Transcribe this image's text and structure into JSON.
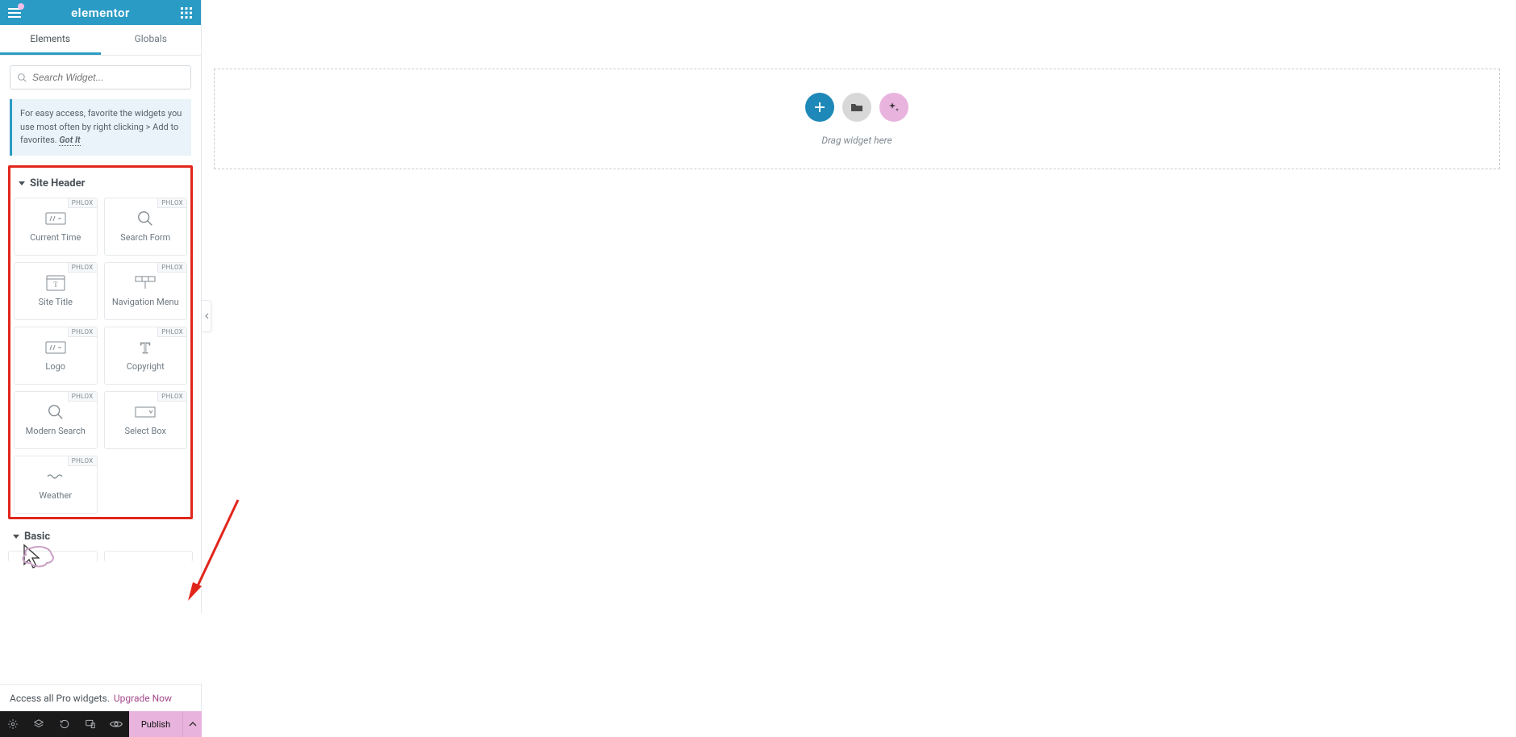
{
  "header": {
    "brand": "elementor"
  },
  "tabs": {
    "elements": "Elements",
    "globals": "Globals"
  },
  "search": {
    "placeholder": "Search Widget..."
  },
  "tip": {
    "text": "For easy access, favorite the widgets you use most often by right clicking > Add to favorites. ",
    "gotit": "Got It"
  },
  "categories": {
    "siteheader": "Site Header",
    "basic": "Basic"
  },
  "tag": "PHLOX",
  "widgets": {
    "current_time": "Current Time",
    "search_form": "Search Form",
    "site_title": "Site Title",
    "navigation_menu": "Navigation Menu",
    "logo": "Logo",
    "copyright": "Copyright",
    "modern_search": "Modern Search",
    "select_box": "Select Box",
    "weather": "Weather"
  },
  "pro_banner": {
    "text": "Access all Pro widgets.",
    "link": "Upgrade Now"
  },
  "bottom": {
    "publish": "Publish"
  },
  "canvas": {
    "hint": "Drag widget here"
  }
}
